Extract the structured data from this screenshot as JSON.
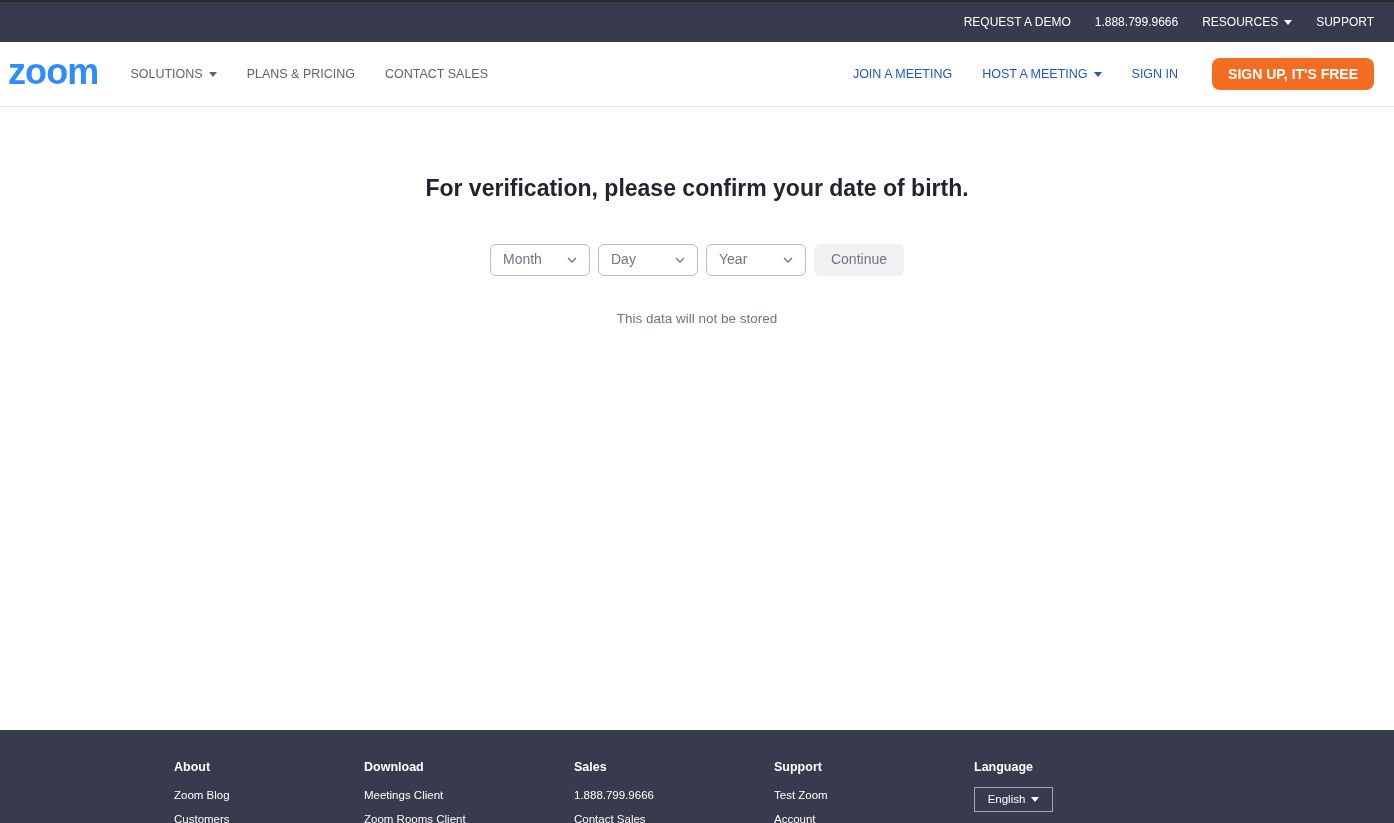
{
  "top_bar": {
    "links": [
      {
        "label": "REQUEST A DEMO",
        "dropdown": false
      },
      {
        "label": "1.888.799.9666",
        "dropdown": false
      },
      {
        "label": "RESOURCES",
        "dropdown": true
      },
      {
        "label": "SUPPORT",
        "dropdown": false
      }
    ]
  },
  "nav": {
    "logo": "zoom",
    "left_links": [
      {
        "label": "SOLUTIONS",
        "dropdown": true
      },
      {
        "label": "PLANS & PRICING",
        "dropdown": false
      },
      {
        "label": "CONTACT SALES",
        "dropdown": false
      }
    ],
    "right_links": [
      {
        "label": "JOIN A MEETING",
        "dropdown": false
      },
      {
        "label": "HOST A MEETING",
        "dropdown": true
      },
      {
        "label": "SIGN IN",
        "dropdown": false
      }
    ],
    "cta": "SIGN UP, IT'S FREE"
  },
  "verification": {
    "title": "For verification, please confirm your date of birth.",
    "selects": [
      {
        "placeholder": "Month"
      },
      {
        "placeholder": "Day"
      },
      {
        "placeholder": "Year"
      }
    ],
    "button": {
      "label": "Continue",
      "disabled": true
    },
    "note": "This data will not be stored"
  },
  "footer": {
    "columns": [
      {
        "heading": "About",
        "links": [
          "Zoom Blog",
          "Customers"
        ]
      },
      {
        "heading": "Download",
        "links": [
          "Meetings Client",
          "Zoom Rooms Client"
        ]
      },
      {
        "heading": "Sales",
        "links": [
          "1.888.799.9666",
          "Contact Sales"
        ]
      },
      {
        "heading": "Support",
        "links": [
          "Test Zoom",
          "Account"
        ]
      }
    ],
    "language": {
      "heading": "Language",
      "value": "English"
    }
  }
}
